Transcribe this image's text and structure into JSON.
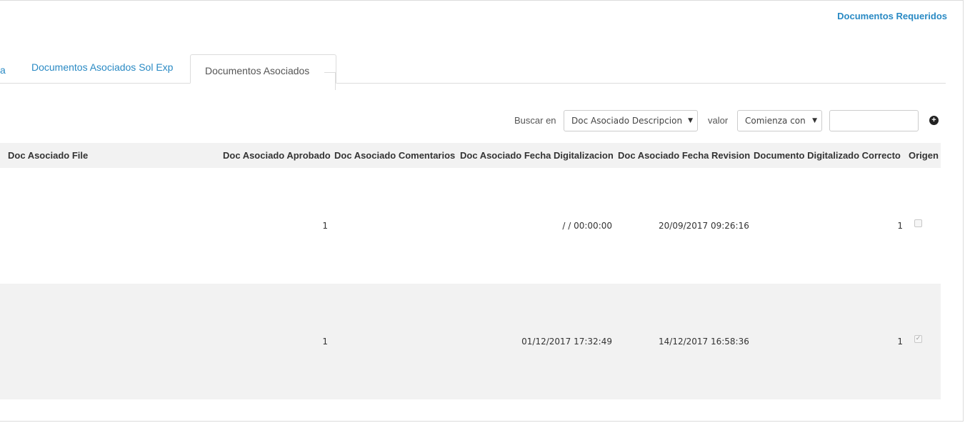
{
  "header": {
    "link_label": "Documentos Requeridos"
  },
  "tabs": [
    {
      "label": "a",
      "active": false
    },
    {
      "label": "Documentos Asociados Sol Exp",
      "active": false
    },
    {
      "label": "Documentos Asociados",
      "active": true
    }
  ],
  "search": {
    "buscar_label": "Buscar en",
    "field_value": "Doc Asociado Descripcion",
    "valor_label": "valor",
    "operator_value": "Comienza con",
    "input_value": "",
    "add_icon": "plus-circle-icon"
  },
  "table": {
    "columns": [
      "Doc Asociado File",
      "Doc Asociado Aprobado",
      "Doc Asociado Comentarios",
      "Doc Asociado Fecha Digitalizacion",
      "Doc Asociado Fecha Revision",
      "Documento Digitalizado Correcto",
      "Origen"
    ],
    "rows": [
      {
        "file": "",
        "aprobado": "1",
        "comentarios": "",
        "fecha_digitalizacion": "/ / 00:00:00",
        "fecha_revision": "20/09/2017 09:26:16",
        "correcto": "1",
        "origen_checked": false
      },
      {
        "file": "",
        "aprobado": "1",
        "comentarios": "",
        "fecha_digitalizacion": "01/12/2017 17:32:49",
        "fecha_revision": "14/12/2017 16:58:36",
        "correcto": "1",
        "origen_checked": true
      }
    ]
  },
  "colors": {
    "accent": "#2a8ac4",
    "header_bg": "#f2f2f2",
    "border": "#dcdcdc"
  }
}
